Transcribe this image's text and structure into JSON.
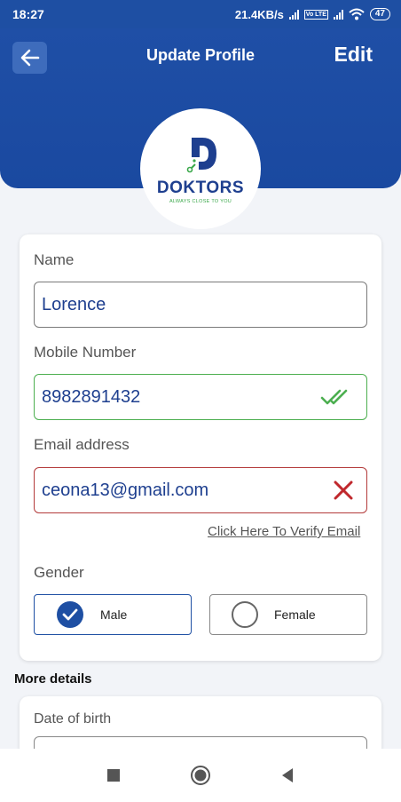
{
  "status_bar": {
    "time": "18:27",
    "network_speed": "21.4KB/s",
    "volte": "Vo LTE",
    "battery": "47"
  },
  "header": {
    "title": "Update Profile",
    "edit_label": "Edit"
  },
  "logo": {
    "brand": "DOKTORS",
    "tagline": "ALWAYS CLOSE TO YOU"
  },
  "form": {
    "name": {
      "label": "Name",
      "value": "Lorence"
    },
    "mobile": {
      "label": "Mobile Number",
      "value": "8982891432",
      "status": "verified"
    },
    "email": {
      "label": "Email address",
      "value": "ceona13@gmail.com",
      "status": "unverified"
    },
    "verify_link": "Click Here To Verify Email",
    "gender": {
      "label": "Gender",
      "options": [
        "Male",
        "Female"
      ],
      "selected": "Male"
    }
  },
  "more_details": {
    "title": "More details",
    "dob_label": "Date of birth"
  },
  "colors": {
    "primary": "#1e4fa3",
    "success": "#4caf50",
    "error": "#b33a3a"
  },
  "icons": {
    "back": "arrow-left-icon",
    "mobile_status": "double-check-icon",
    "email_status": "close-icon",
    "nav": [
      "recents-square-icon",
      "home-circle-icon",
      "back-triangle-icon"
    ]
  }
}
